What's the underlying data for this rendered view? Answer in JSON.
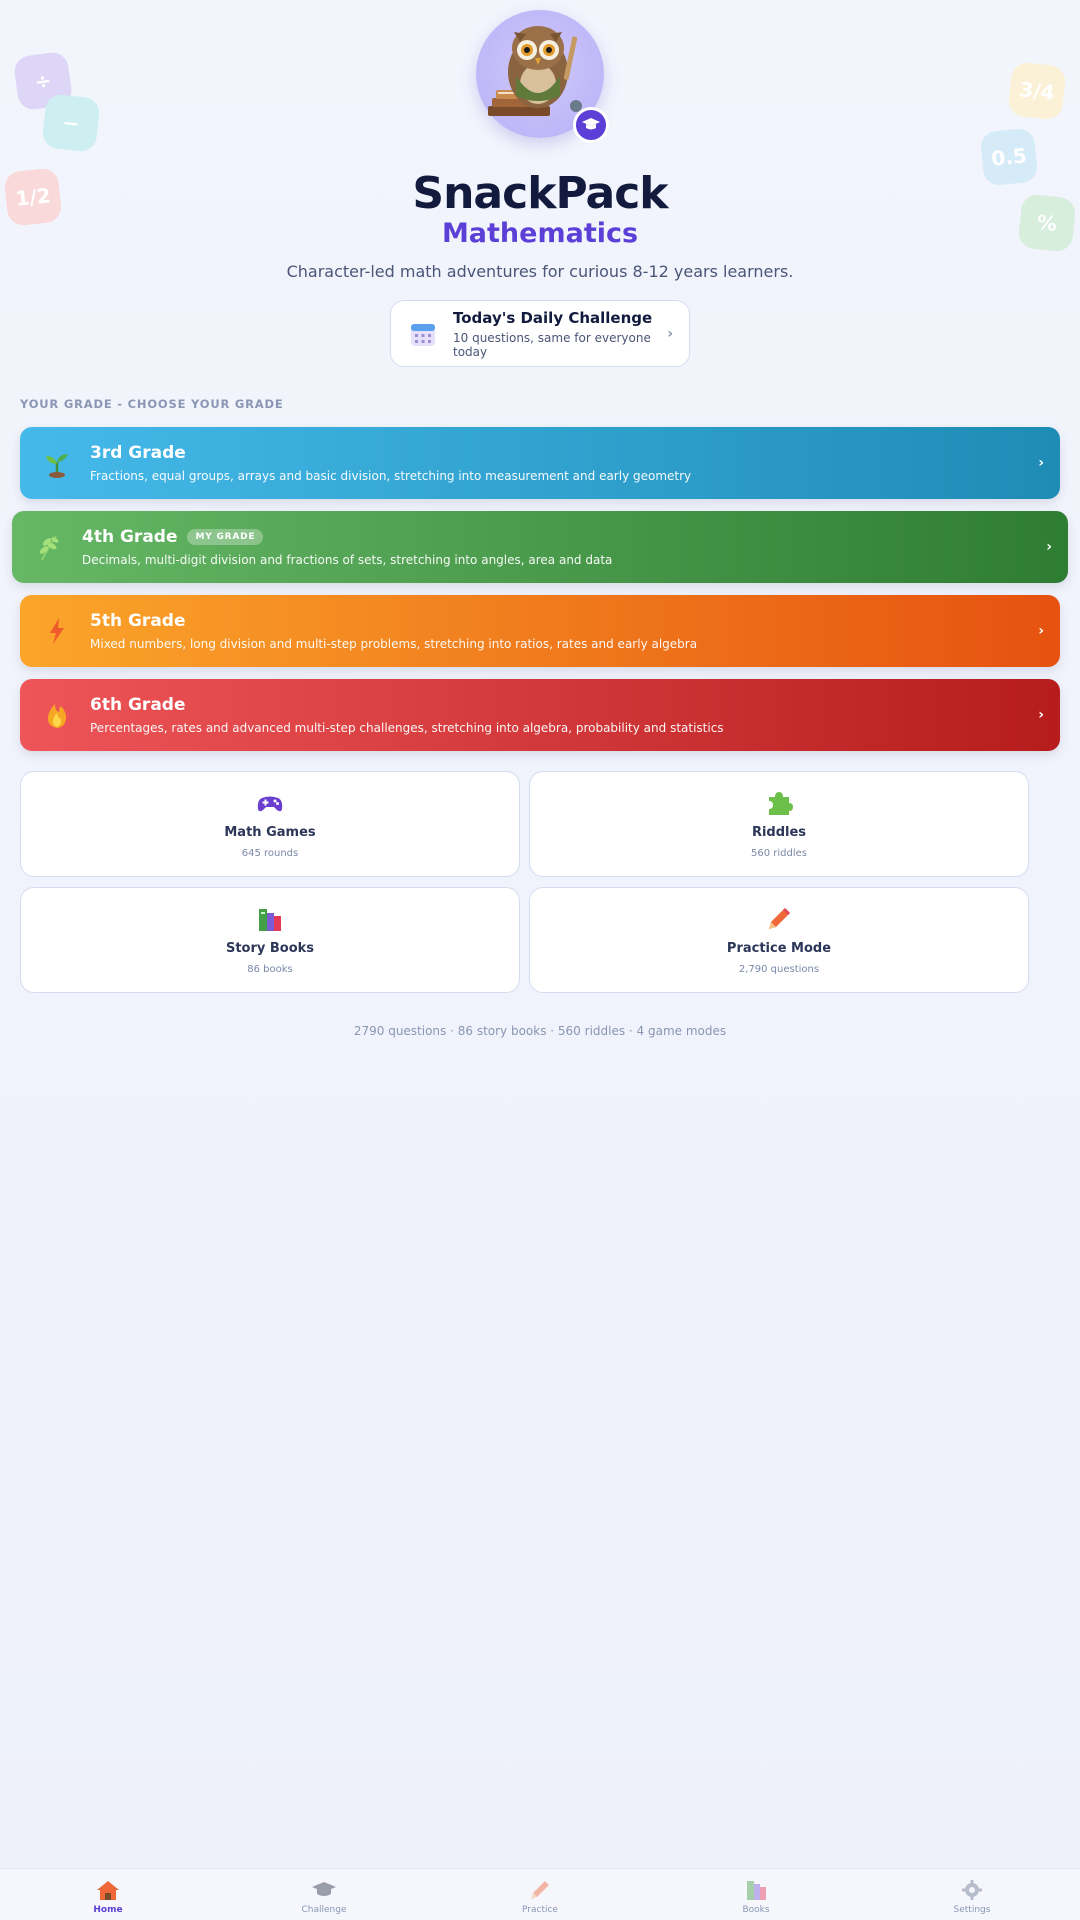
{
  "decor": {
    "tiles": [
      "÷",
      "−",
      "1/2",
      "3/4",
      "0.5",
      "%"
    ]
  },
  "header": {
    "title": "SnackPack",
    "subtitle": "Mathematics",
    "tagline": "Character-led math adventures for curious 8-12 years learners."
  },
  "daily_challenge": {
    "title": "Today's Daily Challenge",
    "subtitle": "10 questions, same for everyone today",
    "icon": "calendar-icon"
  },
  "grades_section": {
    "label": "YOUR GRADE - CHOOSE YOUR GRADE",
    "items": [
      {
        "title": "3rd Grade",
        "description": "Fractions, equal groups, arrays and basic division, stretching into measurement and early geometry",
        "icon": "seedling-icon",
        "color": "#2ea6d8"
      },
      {
        "title": "4th Grade",
        "badge": "MY GRADE",
        "description": "Decimals, multi-digit division and fractions of sets, stretching into angles, area and data",
        "icon": "herb-icon",
        "color": "#43a047"
      },
      {
        "title": "5th Grade",
        "description": "Mixed numbers, long division and multi-step problems, stretching into ratios, rates and early algebra",
        "icon": "lightning-icon",
        "color": "#f57c1f"
      },
      {
        "title": "6th Grade",
        "description": "Percentages, rates and advanced multi-step challenges, stretching into algebra, probability and statistics",
        "icon": "fire-icon",
        "color": "#d32f2f"
      }
    ]
  },
  "features": [
    {
      "title": "Math Games",
      "subtitle": "645 rounds",
      "icon": "gamepad-icon"
    },
    {
      "title": "Riddles",
      "subtitle": "560 riddles",
      "icon": "puzzle-icon"
    },
    {
      "title": "Story Books",
      "subtitle": "86 books",
      "icon": "books-icon"
    },
    {
      "title": "Practice Mode",
      "subtitle": "2,790 questions",
      "icon": "pencil-icon"
    }
  ],
  "stats_line": "2790 questions · 86 story books · 560 riddles · 4 game modes",
  "nav": {
    "items": [
      {
        "label": "Home",
        "icon": "house-icon",
        "active": true
      },
      {
        "label": "Challenge",
        "icon": "graduation-cap-icon"
      },
      {
        "label": "Practice",
        "icon": "pencil-icon"
      },
      {
        "label": "Books",
        "icon": "books-icon"
      },
      {
        "label": "Settings",
        "icon": "gear-icon"
      }
    ]
  }
}
